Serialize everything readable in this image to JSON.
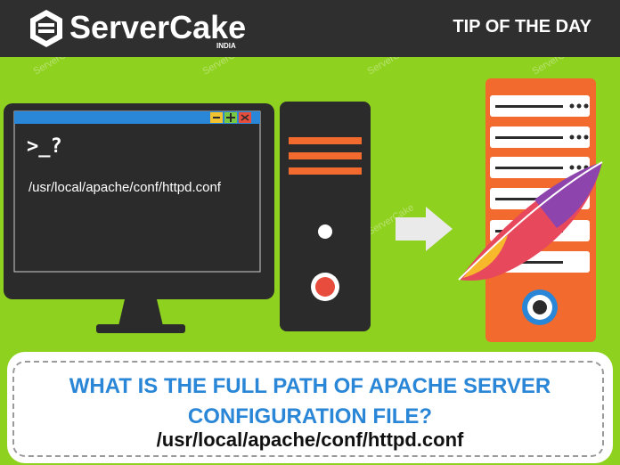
{
  "header": {
    "brand_name": "ServerCake",
    "brand_sub": "INDIA",
    "tip_label": "TIP OF THE DAY"
  },
  "terminal": {
    "prompt": ">_?",
    "path": "/usr/local/apache/conf/httpd.conf"
  },
  "question": {
    "line1": "WHAT IS THE FULL PATH OF APACHE SERVER",
    "line2": "CONFIGURATION FILE?",
    "answer": "/usr/local/apache/conf/httpd.conf"
  },
  "watermark": "ServerCake",
  "colors": {
    "background": "#8fd11f",
    "header": "#2f2f2f",
    "accent_blue": "#2a86d6",
    "server_orange": "#f26a2e"
  },
  "icons": [
    "servercake-logo-icon",
    "minimize-icon",
    "maximize-icon",
    "close-icon",
    "arrow-right-icon",
    "apache-feather-icon"
  ]
}
